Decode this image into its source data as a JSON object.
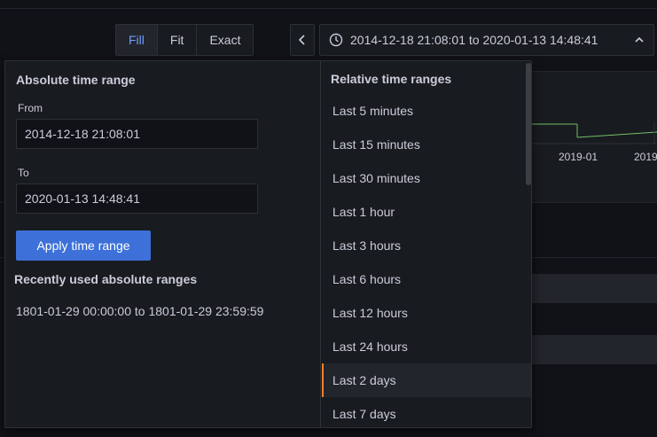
{
  "toolbar": {
    "segments": [
      "Fill",
      "Fit",
      "Exact"
    ],
    "active_segment": "Fill",
    "time_range_label": "2014-12-18 21:08:01 to 2020-01-13 14:48:41"
  },
  "background_graph": {
    "ticks": [
      "2019-01",
      "2019"
    ]
  },
  "absolute": {
    "title": "Absolute time range",
    "from_label": "From",
    "from_value": "2014-12-18 21:08:01",
    "to_label": "To",
    "to_value": "2020-01-13 14:48:41",
    "apply_label": "Apply time range",
    "recent_title": "Recently used absolute ranges",
    "recent_items": [
      "1801-01-29 00:00:00 to 1801-01-29 23:59:59"
    ]
  },
  "relative": {
    "title": "Relative time ranges",
    "items": [
      "Last 5 minutes",
      "Last 15 minutes",
      "Last 30 minutes",
      "Last 1 hour",
      "Last 3 hours",
      "Last 6 hours",
      "Last 12 hours",
      "Last 24 hours",
      "Last 2 days",
      "Last 7 days"
    ],
    "selected": "Last 2 days"
  },
  "colors": {
    "accent": "#3d71d9",
    "active_text": "#6e9fff",
    "selected_marker": "#ff7f2a",
    "graph_line": "#73bf69"
  }
}
